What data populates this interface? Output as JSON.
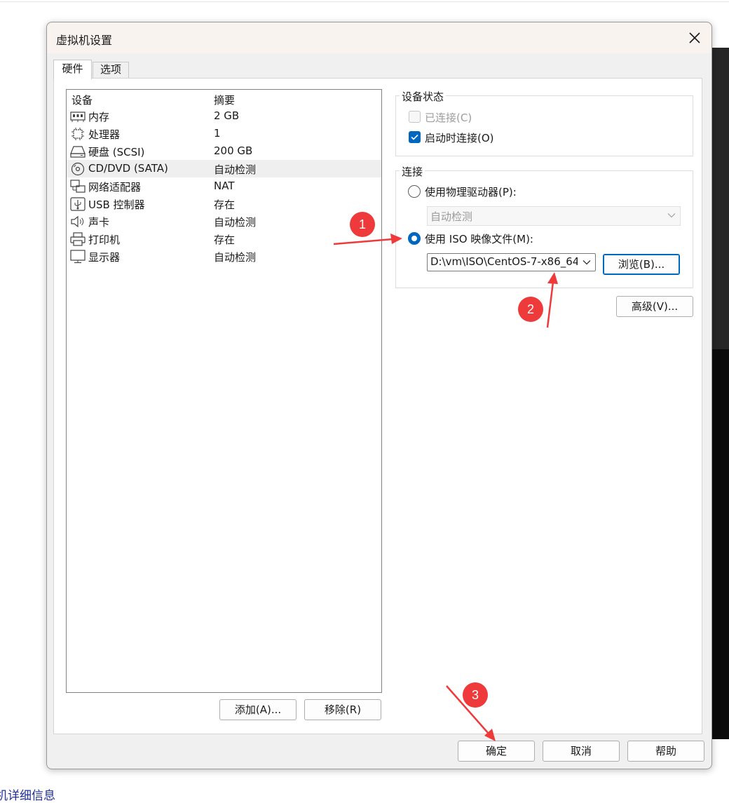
{
  "dialog": {
    "title": "虚拟机设置",
    "tabs": [
      {
        "label": "硬件",
        "active": true
      },
      {
        "label": "选项",
        "active": false
      }
    ]
  },
  "device_list": {
    "columns": {
      "device": "设备",
      "summary": "摘要"
    },
    "rows": [
      {
        "icon": "memory-icon",
        "name": "内存",
        "summary": "2 GB"
      },
      {
        "icon": "processor-icon",
        "name": "处理器",
        "summary": "1"
      },
      {
        "icon": "hard-disk-icon",
        "name": "硬盘 (SCSI)",
        "summary": "200 GB"
      },
      {
        "icon": "cd-dvd-icon",
        "name": "CD/DVD (SATA)",
        "summary": "自动检测",
        "selected": true
      },
      {
        "icon": "network-adapter-icon",
        "name": "网络适配器",
        "summary": "NAT"
      },
      {
        "icon": "usb-controller-icon",
        "name": "USB 控制器",
        "summary": "存在"
      },
      {
        "icon": "sound-card-icon",
        "name": "声卡",
        "summary": "自动检测"
      },
      {
        "icon": "printer-icon",
        "name": "打印机",
        "summary": "存在"
      },
      {
        "icon": "display-icon",
        "name": "显示器",
        "summary": "自动检测"
      }
    ],
    "add_button": "添加(A)...",
    "remove_button": "移除(R)"
  },
  "device_status": {
    "label": "设备状态",
    "connected": {
      "label": "已连接(C)",
      "checked": false,
      "enabled": false
    },
    "connect_at_power_on": {
      "label": "启动时连接(O)",
      "checked": true
    }
  },
  "connection": {
    "label": "连接",
    "physical_drive": {
      "label": "使用物理驱动器(P):",
      "selected": false,
      "value": "自动检测"
    },
    "iso_image": {
      "label": "使用 ISO 映像文件(M):",
      "selected": true,
      "path": "D:\\vm\\ISO\\CentOS-7-x86_64"
    },
    "browse_button": "浏览(B)..."
  },
  "advanced_button": "高级(V)...",
  "footer": {
    "ok": "确定",
    "cancel": "取消",
    "help": "帮助"
  },
  "annotations": [
    "1",
    "2",
    "3"
  ],
  "background": {
    "link_text": "机详细信息"
  },
  "colors": {
    "accent": "#0067c0",
    "marker": "#ee3a3a"
  }
}
